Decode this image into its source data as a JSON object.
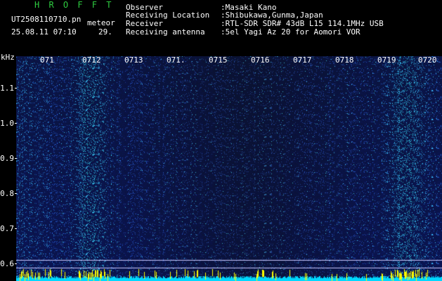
{
  "header": {
    "title": "H R O F F T",
    "filename": "UT2508110710.pn",
    "type_label": "meteor",
    "date_time": "25.08.11 07:10",
    "level": "29."
  },
  "info": {
    "observer_label": "Observer",
    "observer_value": ":Masaki Kano",
    "location_label": "Receiving Location",
    "location_value": ":Shibukawa,Gunma,Japan",
    "receiver_label": "Receiver",
    "receiver_value": ":RTL-SDR SDR# 43dB L15 114.1MHz USB",
    "antenna_label": "Receiving antenna",
    "antenna_value": ":5el Yagi Az 20 for Aomori VOR"
  },
  "axes": {
    "y_unit": "kHz",
    "y_ticks": [
      "1.1",
      "1.0",
      "0.9",
      "0.8",
      "0.7",
      "0.6"
    ],
    "x_ticks": [
      "071",
      "0712",
      "0713",
      "071.",
      "0715",
      "0716",
      "0717",
      "0718",
      "0719",
      "0720"
    ]
  },
  "colors": {
    "background": "#000000",
    "spectrum_blue": "#1a2aa8",
    "signal_cyan": "#00e0ff",
    "title_green": "#2ecc40"
  }
}
